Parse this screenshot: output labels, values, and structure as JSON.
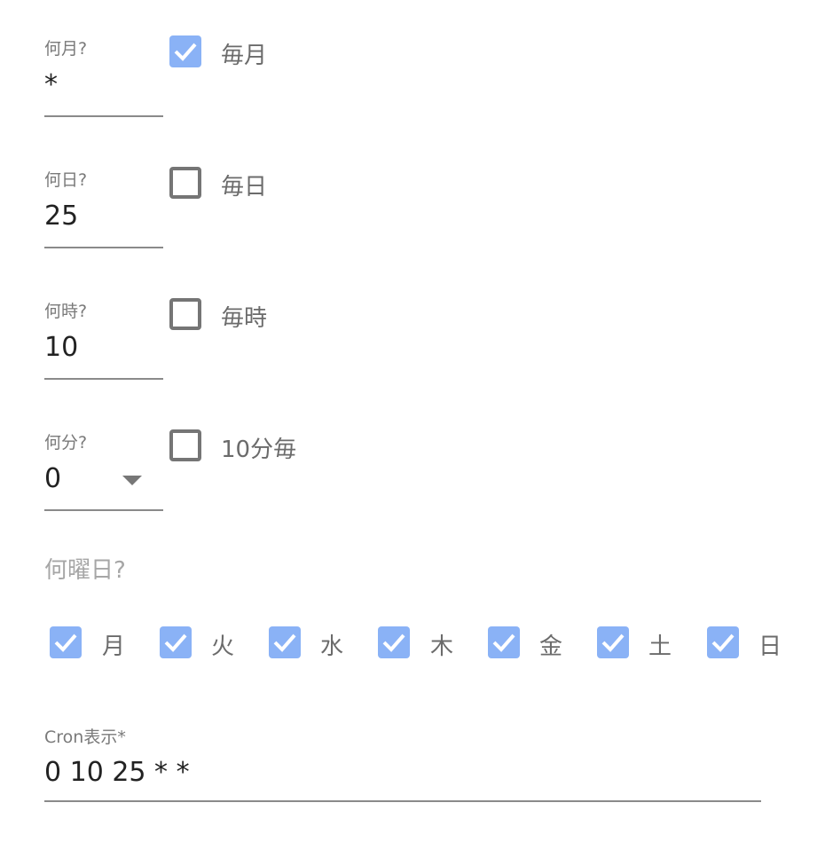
{
  "schedule": {
    "month": {
      "label": "何月?",
      "value": "*",
      "every_label": "毎月",
      "every_checked": true
    },
    "day": {
      "label": "何日?",
      "value": "25",
      "every_label": "毎日",
      "every_checked": false
    },
    "hour": {
      "label": "何時?",
      "value": "10",
      "every_label": "毎時",
      "every_checked": false
    },
    "minute": {
      "label": "何分?",
      "value": "0",
      "every_label": "10分毎",
      "every_checked": false
    }
  },
  "weekdays": {
    "title": "何曜日?",
    "items": [
      {
        "label": "月",
        "checked": true
      },
      {
        "label": "火",
        "checked": true
      },
      {
        "label": "水",
        "checked": true
      },
      {
        "label": "木",
        "checked": true
      },
      {
        "label": "金",
        "checked": true
      },
      {
        "label": "土",
        "checked": true
      },
      {
        "label": "日",
        "checked": true
      }
    ]
  },
  "cron": {
    "label": "Cron表示*",
    "value": "0 10 25 * *"
  },
  "colors": {
    "checkbox_checked": "#8ab2f6",
    "checkbox_border": "#757575",
    "underline": "#8a8a8a"
  }
}
